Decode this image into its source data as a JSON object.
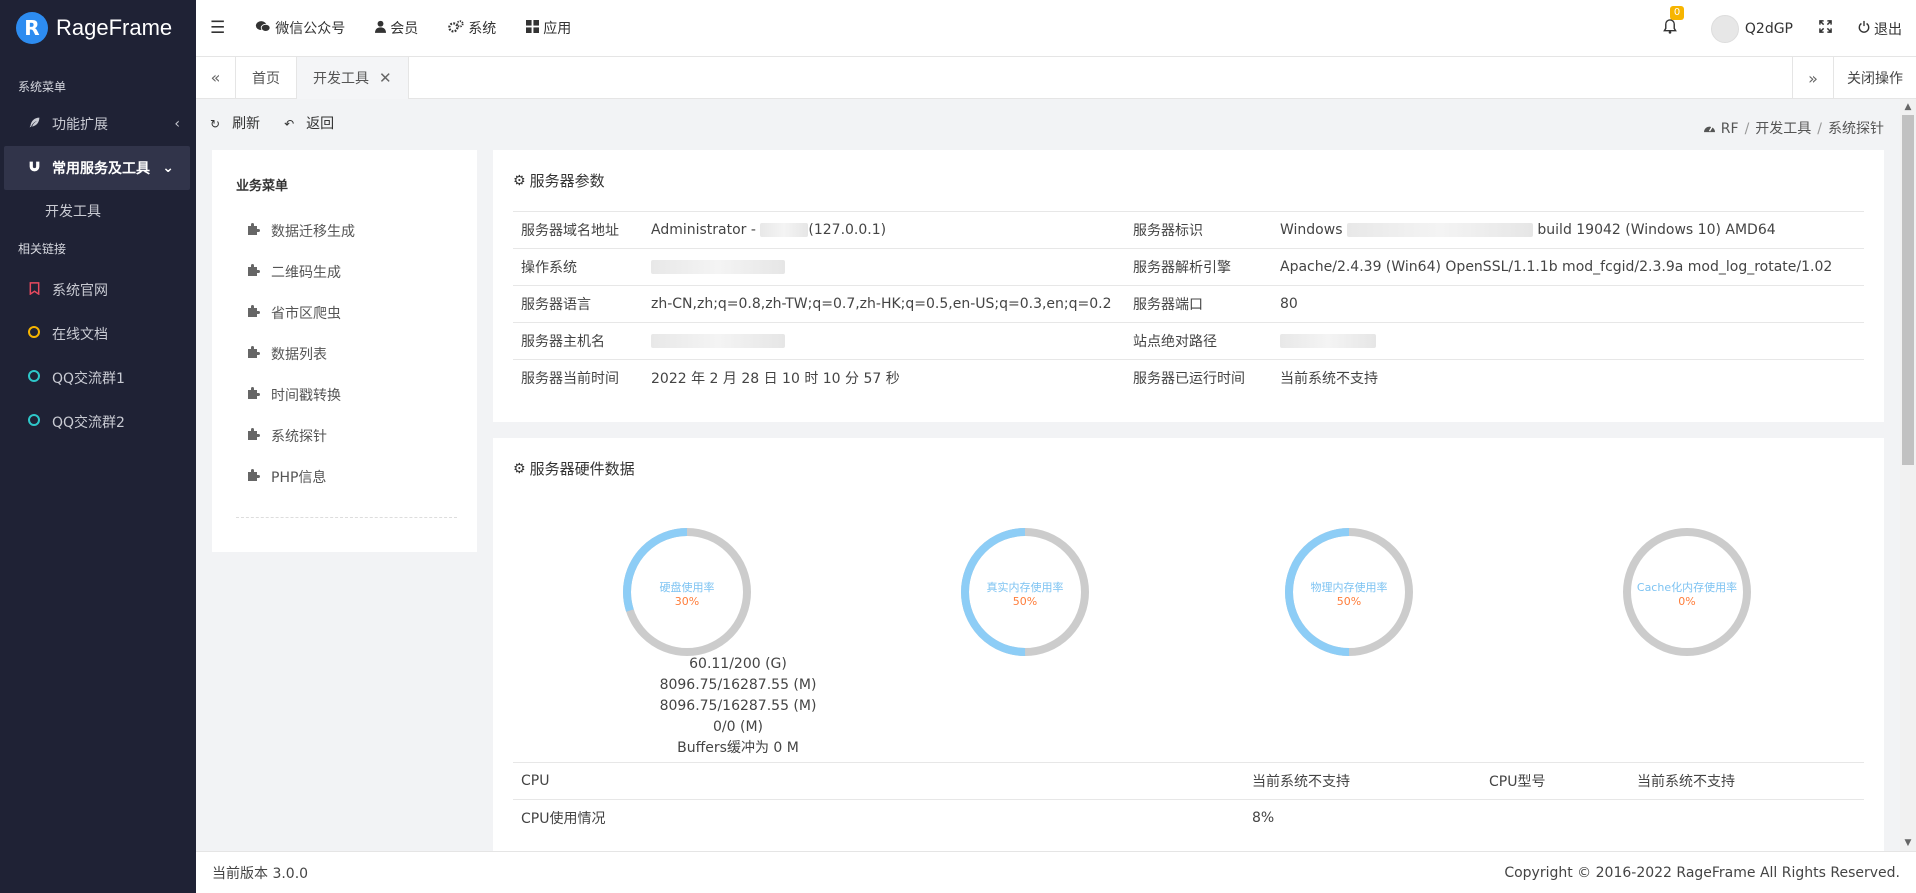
{
  "app": {
    "name": "RageFrame",
    "logo_letter": "R"
  },
  "sidebar": {
    "section1": "系统菜单",
    "items": [
      {
        "label": "功能扩展",
        "icon": "feather-icon"
      },
      {
        "label": "常用服务及工具",
        "icon": "magnet-icon"
      }
    ],
    "sub_item": "开发工具",
    "section2": "相关链接",
    "links": [
      {
        "label": "系统官网",
        "icon": "bookmark-icon",
        "color": "#e84a5f"
      },
      {
        "label": "在线文档",
        "icon": "circle-icon",
        "color": "#f7b500"
      },
      {
        "label": "QQ交流群1",
        "icon": "circle-icon",
        "color": "#2ec7c9"
      },
      {
        "label": "QQ交流群2",
        "icon": "circle-icon",
        "color": "#2ec7c9"
      }
    ]
  },
  "topbar": {
    "menu": [
      {
        "label": "微信公众号",
        "icon": "wechat-icon"
      },
      {
        "label": "会员",
        "icon": "user-icon"
      },
      {
        "label": "系统",
        "icon": "cogs-icon"
      },
      {
        "label": "应用",
        "icon": "grid-icon"
      }
    ],
    "notifications": "0",
    "username": "Q2dGP",
    "logout": "退出"
  },
  "tabs": {
    "items": [
      "首页",
      "开发工具"
    ],
    "close_label": "关闭操作"
  },
  "toolbar": {
    "refresh": "刷新",
    "back": "返回"
  },
  "breadcrumb": [
    "RF",
    "开发工具",
    "系统探针"
  ],
  "left_menu": {
    "title": "业务菜单",
    "items": [
      "数据迁移生成",
      "二维码生成",
      "省市区爬虫",
      "数据列表",
      "时间戳转换",
      "系统探针",
      "PHP信息"
    ]
  },
  "server_params": {
    "title": "服务器参数",
    "rows": [
      {
        "k1": "服务器域名地址",
        "v1_pre": "Administrator - ",
        "v1_post": "(127.0.0.1)",
        "k2": "服务器标识",
        "v2_pre": "Windows ",
        "v2_post": " build 19042 (Windows 10) AMD64"
      },
      {
        "k1": "操作系统",
        "k2": "服务器解析引擎",
        "v2": "Apache/2.4.39 (Win64) OpenSSL/1.1.1b mod_fcgid/2.3.9a mod_log_rotate/1.02"
      },
      {
        "k1": "服务器语言",
        "v1": "zh-CN,zh;q=0.8,zh-TW;q=0.7,zh-HK;q=0.5,en-US;q=0.3,en;q=0.2",
        "k2": "服务器端口",
        "v2": "80"
      },
      {
        "k1": "服务器主机名",
        "k2": "站点绝对路径"
      },
      {
        "k1": "服务器当前时间",
        "v1": "2022 年 2 月 28 日 10 时 10 分 57 秒",
        "k2": "服务器已运行时间",
        "v2": "当前系统不支持"
      }
    ]
  },
  "hardware": {
    "title": "服务器硬件数据",
    "gauges": [
      {
        "label": "硬盘使用率",
        "pct_text": "30%",
        "value": 30
      },
      {
        "label": "真实内存使用率",
        "pct_text": "50%",
        "value": 50
      },
      {
        "label": "物理内存使用率",
        "pct_text": "50%",
        "value": 50
      },
      {
        "label": "Cache化内存使用率",
        "pct_text": "0%",
        "value": 0
      }
    ],
    "disk_lines": [
      "60.11/200 (G)",
      "8096.75/16287.55 (M)",
      "8096.75/16287.55 (M)",
      "0/0 (M)",
      "Buffers缓冲为 0 M"
    ],
    "cpu_rows": [
      {
        "k1": "CPU",
        "v1": "当前系统不支持",
        "k2": "CPU型号",
        "v2": "当前系统不支持"
      },
      {
        "k1": "CPU使用情况",
        "v1": "8%"
      }
    ],
    "colors": {
      "used": "#8dcdf6",
      "free": "#cccccc"
    }
  },
  "footer": {
    "version": "当前版本 3.0.0",
    "copyright": "Copyright © 2016-2022 RageFrame All Rights Reserved."
  }
}
